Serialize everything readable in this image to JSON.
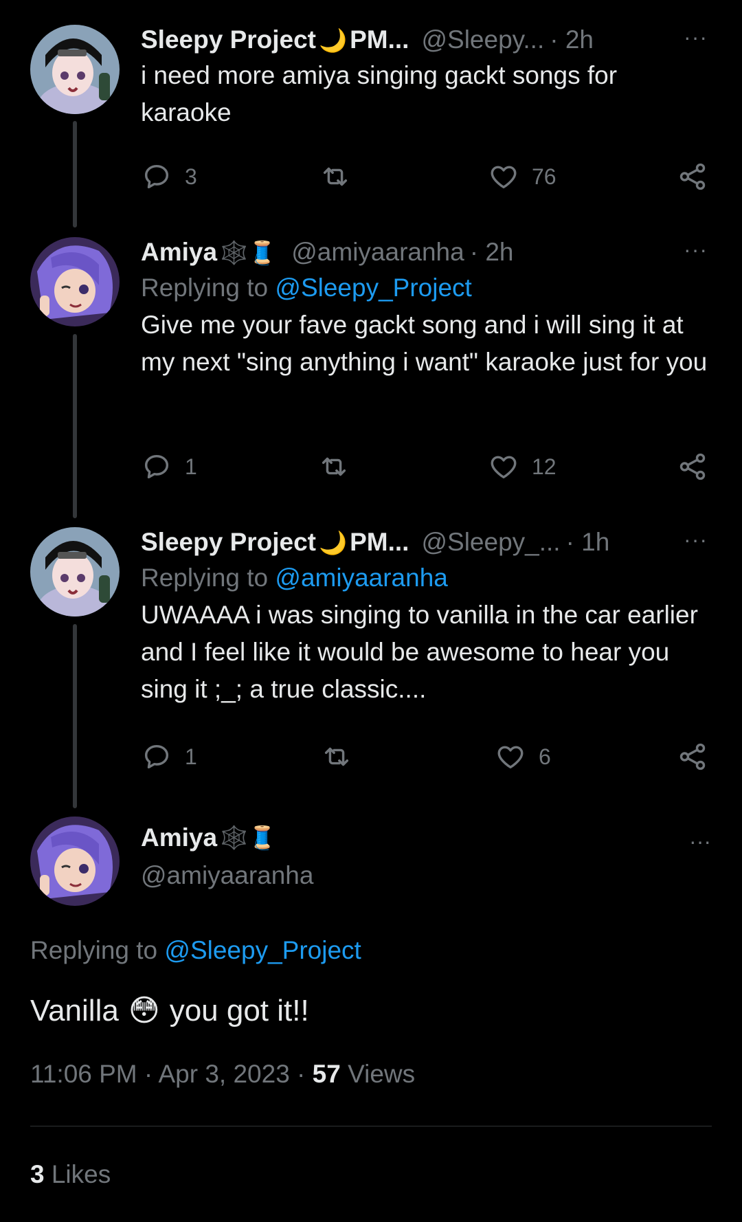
{
  "tweets": [
    {
      "name": "Sleepy Project",
      "name_emoji": "🌙",
      "name_suffix": "PM...",
      "handle": "@Sleepy...",
      "time": "· 2h",
      "replying_prefix": "",
      "replying_to": "",
      "text": "i need more amiya singing gackt songs for karaoke",
      "replies": "3",
      "retweets": "",
      "likes": "76"
    },
    {
      "name": "Amiya",
      "name_emoji": "🕸️🧵",
      "name_suffix": "",
      "handle": "@amiyaaranha",
      "time": "· 2h",
      "replying_prefix": "Replying to",
      "replying_to": "@Sleepy_Project",
      "text": "Give me your fave gackt song and i will sing it at my next \"sing anything i want\" karaoke just for you",
      "replies": "1",
      "retweets": "",
      "likes": "12"
    },
    {
      "name": "Sleepy Project",
      "name_emoji": "🌙",
      "name_suffix": "PM...",
      "handle": "@Sleepy_...",
      "time": "· 1h",
      "replying_prefix": "Replying to",
      "replying_to": "@amiyaaranha",
      "text": "UWAAAA i was singing to vanilla in the car earlier and I feel like it would be awesome to hear you sing it ;_; a true classic....",
      "replies": "1",
      "retweets": "",
      "likes": "6"
    }
  ],
  "main_tweet": {
    "name": "Amiya",
    "name_emoji": "🕸️🧵",
    "handle": "@amiyaaranha",
    "replying_prefix": "Replying to",
    "replying_to": "@Sleepy_Project",
    "text_before": "Vanilla",
    "text_emoji": "😳",
    "text_after": "you got it!!",
    "time": "11:06 PM · Apr 3, 2023 ·",
    "views_count": "57",
    "views_label": "Views",
    "likes_count": "3",
    "likes_label": "Likes"
  },
  "more_icon": "···",
  "colors": {
    "accent": "#1d9bf0",
    "muted": "#71767b",
    "background": "#000000",
    "text": "#e7e9ea"
  }
}
